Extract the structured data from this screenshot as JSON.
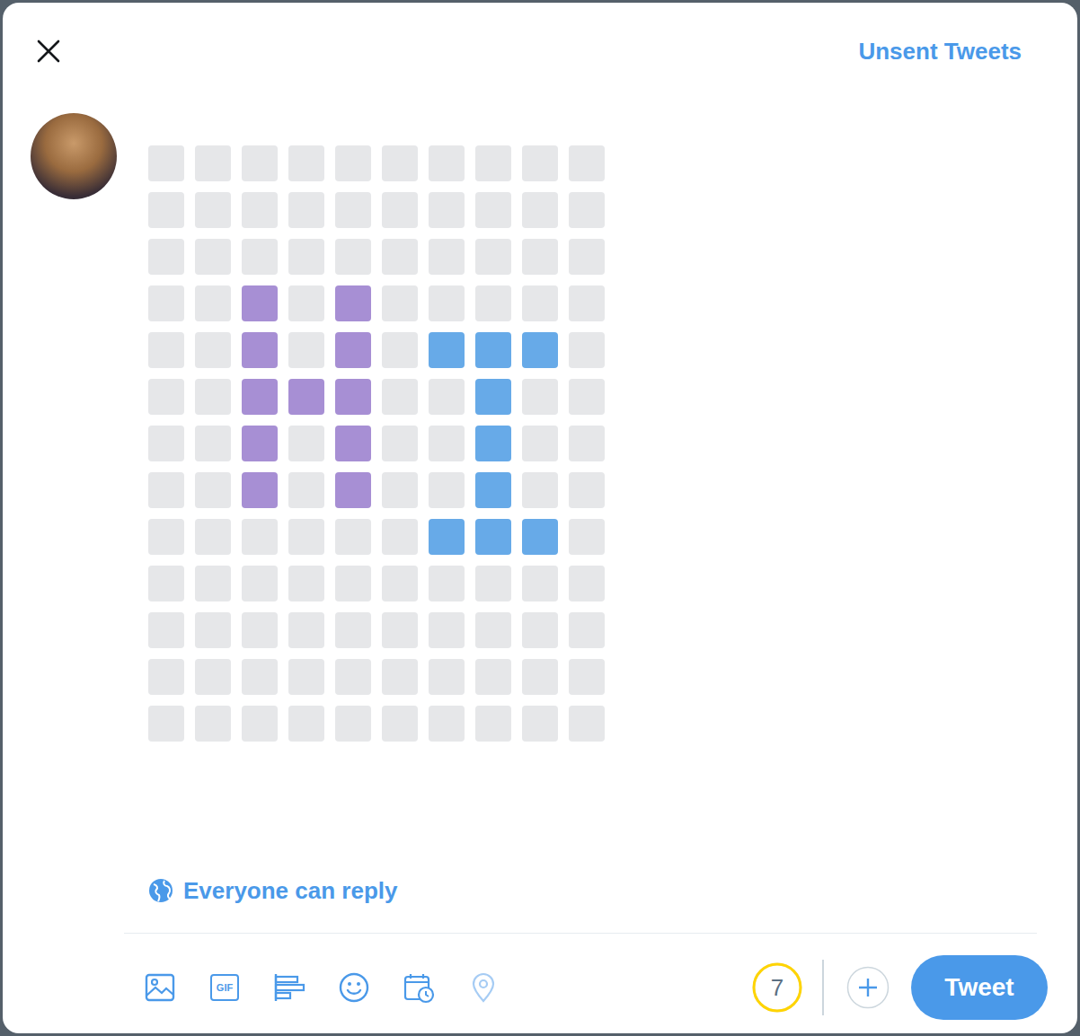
{
  "header": {
    "unsent_link": "Unsent Tweets"
  },
  "composer": {
    "rows": [
      [
        "#e6e7e9",
        "#e6e7e9",
        "#e6e7e9",
        "#e6e7e9",
        "#e6e7e9",
        "#e6e7e9",
        "#e6e7e9",
        "#e6e7e9",
        "#e6e7e9",
        "#e6e7e9"
      ],
      [
        "#e6e7e9",
        "#e6e7e9",
        "#e6e7e9",
        "#e6e7e9",
        "#e6e7e9",
        "#e6e7e9",
        "#e6e7e9",
        "#e6e7e9",
        "#e6e7e9",
        "#e6e7e9"
      ],
      [
        "#e6e7e9",
        "#e6e7e9",
        "#e6e7e9",
        "#e6e7e9",
        "#e6e7e9",
        "#e6e7e9",
        "#e6e7e9",
        "#e6e7e9",
        "#e6e7e9",
        "#e6e7e9"
      ],
      [
        "#e6e7e9",
        "#e6e7e9",
        "#a78fd4",
        "#e6e7e9",
        "#a78fd4",
        "#e6e7e9",
        "#e6e7e9",
        "#e6e7e9",
        "#e6e7e9",
        "#e6e7e9"
      ],
      [
        "#e6e7e9",
        "#e6e7e9",
        "#a78fd4",
        "#e6e7e9",
        "#a78fd4",
        "#e6e7e9",
        "#67aae8",
        "#67aae8",
        "#67aae8",
        "#e6e7e9"
      ],
      [
        "#e6e7e9",
        "#e6e7e9",
        "#a78fd4",
        "#a78fd4",
        "#a78fd4",
        "#e6e7e9",
        "#e6e7e9",
        "#67aae8",
        "#e6e7e9",
        "#e6e7e9"
      ],
      [
        "#e6e7e9",
        "#e6e7e9",
        "#a78fd4",
        "#e6e7e9",
        "#a78fd4",
        "#e6e7e9",
        "#e6e7e9",
        "#67aae8",
        "#e6e7e9",
        "#e6e7e9"
      ],
      [
        "#e6e7e9",
        "#e6e7e9",
        "#a78fd4",
        "#e6e7e9",
        "#a78fd4",
        "#e6e7e9",
        "#e6e7e9",
        "#67aae8",
        "#e6e7e9",
        "#e6e7e9"
      ],
      [
        "#e6e7e9",
        "#e6e7e9",
        "#e6e7e9",
        "#e6e7e9",
        "#e6e7e9",
        "#e6e7e9",
        "#67aae8",
        "#67aae8",
        "#67aae8",
        "#e6e7e9"
      ],
      [
        "#e6e7e9",
        "#e6e7e9",
        "#e6e7e9",
        "#e6e7e9",
        "#e6e7e9",
        "#e6e7e9",
        "#e6e7e9",
        "#e6e7e9",
        "#e6e7e9",
        "#e6e7e9"
      ],
      [
        "#e6e7e9",
        "#e6e7e9",
        "#e6e7e9",
        "#e6e7e9",
        "#e6e7e9",
        "#e6e7e9",
        "#e6e7e9",
        "#e6e7e9",
        "#e6e7e9",
        "#e6e7e9"
      ],
      [
        "#e6e7e9",
        "#e6e7e9",
        "#e6e7e9",
        "#e6e7e9",
        "#e6e7e9",
        "#e6e7e9",
        "#e6e7e9",
        "#e6e7e9",
        "#e6e7e9",
        "#e6e7e9"
      ],
      [
        "#e6e7e9",
        "#e6e7e9",
        "#e6e7e9",
        "#e6e7e9",
        "#e6e7e9",
        "#e6e7e9",
        "#e6e7e9",
        "#e6e7e9",
        "#e6e7e9",
        "#e6e7e9"
      ]
    ]
  },
  "reply_setting": {
    "label": "Everyone can reply"
  },
  "toolbar": {
    "gif_label": "GIF",
    "location_disabled": true
  },
  "counter": {
    "remaining": "7",
    "level": 1
  },
  "tweet_button": {
    "label": "Tweet"
  }
}
